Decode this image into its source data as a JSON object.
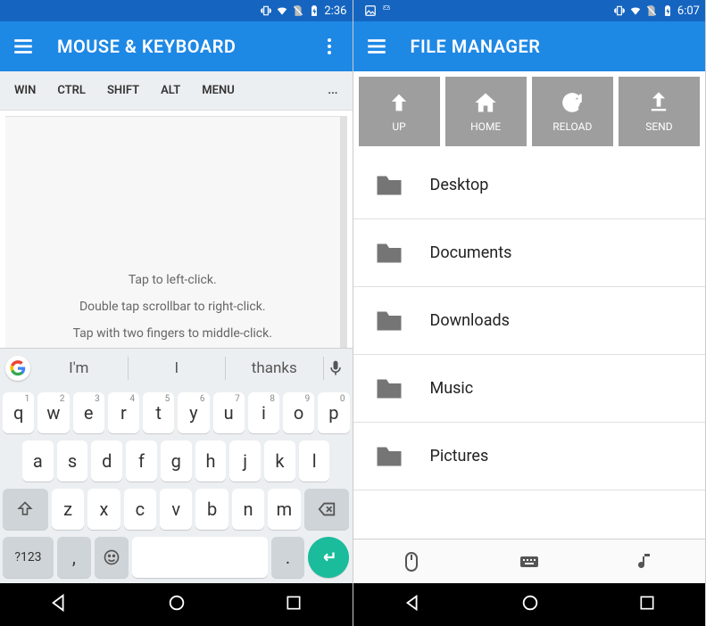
{
  "left": {
    "status": {
      "time": "2:36"
    },
    "appbar": {
      "title": "MOUSE & KEYBOARD"
    },
    "modkeys": {
      "win": "WIN",
      "ctrl": "CTRL",
      "shift": "SHIFT",
      "alt": "ALT",
      "menu": "MENU",
      "more": "..."
    },
    "touchpad": {
      "line1": "Tap to left-click.",
      "line2": "Double tap scrollbar to right-click.",
      "line3": "Tap with two fingers to middle-click."
    },
    "suggest": {
      "s1": "I'm",
      "s2": "I",
      "s3": "thanks"
    },
    "keys": {
      "row1": [
        "q",
        "w",
        "e",
        "r",
        "t",
        "y",
        "u",
        "i",
        "o",
        "p"
      ],
      "row1sup": [
        "1",
        "2",
        "3",
        "4",
        "5",
        "6",
        "7",
        "8",
        "9",
        "0"
      ],
      "row2": [
        "a",
        "s",
        "d",
        "f",
        "g",
        "h",
        "j",
        "k",
        "l"
      ],
      "row3": [
        "z",
        "x",
        "c",
        "v",
        "b",
        "n",
        "m"
      ],
      "symKey": "?123",
      "comma": ",",
      "period": "."
    }
  },
  "right": {
    "status": {
      "time": "6:07"
    },
    "appbar": {
      "title": "FILE MANAGER"
    },
    "actions": {
      "up": "UP",
      "home": "HOME",
      "reload": "RELOAD",
      "send": "SEND"
    },
    "folders": {
      "f1": "Desktop",
      "f2": "Documents",
      "f3": "Downloads",
      "f4": "Music",
      "f5": "Pictures"
    }
  }
}
